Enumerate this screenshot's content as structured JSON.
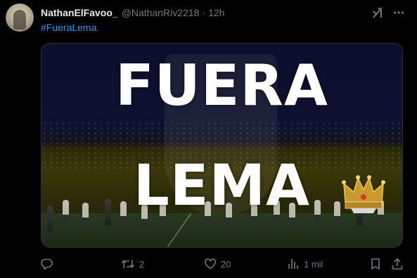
{
  "post": {
    "display_name": "NathanElFavoo_",
    "handle": "@NathanRiv2218",
    "separator": "·",
    "time": "12h",
    "hashtag": "#FueraLema"
  },
  "media": {
    "banner_line_1": "FUERA",
    "banner_line_2": "LEMA"
  },
  "actions": {
    "reply_count": "",
    "retweet_count": "2",
    "like_count": "20",
    "views_count": "1 mil"
  },
  "icons": {
    "grok": "grok-icon",
    "more": "more-icon",
    "reply": "reply-icon",
    "retweet": "retweet-icon",
    "like": "heart-icon",
    "views": "views-icon",
    "bookmark": "bookmark-icon",
    "share": "share-icon"
  },
  "colors": {
    "background": "#000000",
    "text": "#e7e9ea",
    "muted": "#71767b",
    "link": "#1d9bf0"
  }
}
